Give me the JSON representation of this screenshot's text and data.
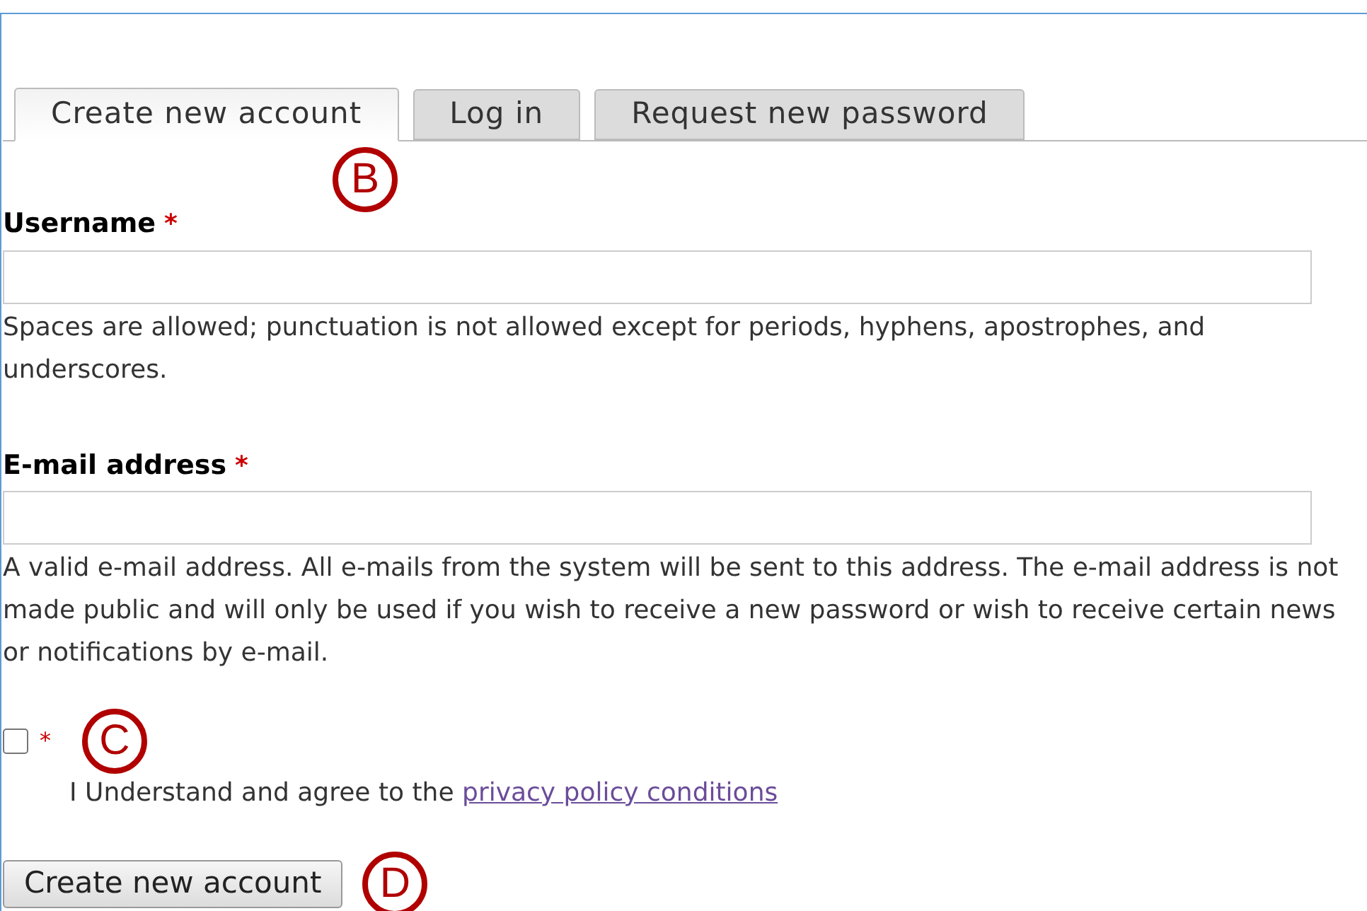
{
  "tabs": [
    {
      "label": "Create new account",
      "selected": true
    },
    {
      "label": "Log in",
      "selected": false
    },
    {
      "label": "Request new password",
      "selected": false
    }
  ],
  "fields": [
    {
      "label": "Username",
      "required_mark": "*",
      "description": "Spaces are allowed; punctuation is not allowed except for periods, hyphens, apostrophes, and underscores."
    },
    {
      "label": "E-mail address",
      "required_mark": "*",
      "description": "A valid e-mail address. All e-mails from the system will be sent to this address. The e-mail address is not made public and will only be used if you wish to receive a new password or wish to receive certain news or notifications by e-mail."
    }
  ],
  "agreement": {
    "checked": false,
    "required_mark": "*",
    "text": "I Understand and agree to the ",
    "link": "privacy policy conditions"
  },
  "submit_button": "Create new account",
  "callouts": [
    {
      "letter": "B"
    },
    {
      "letter": "C"
    },
    {
      "letter": "D"
    }
  ]
}
